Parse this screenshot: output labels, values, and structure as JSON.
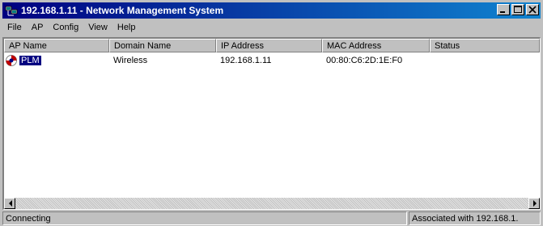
{
  "window": {
    "title": "192.168.1.11 - Network Management System",
    "icon": "network-computers-icon"
  },
  "menu": {
    "items": [
      "File",
      "AP",
      "Config",
      "View",
      "Help"
    ]
  },
  "table": {
    "columns": [
      "AP Name",
      "Domain Name",
      "IP Address",
      "MAC Address",
      "Status"
    ],
    "rows": [
      {
        "icon": "access-point-icon",
        "ap_name": "PLM",
        "domain_name": "Wireless",
        "ip_address": "192.168.1.11",
        "mac_address": "00:80:C6:2D:1E:F0",
        "status": ""
      }
    ],
    "selected_row": 0
  },
  "status_bar": {
    "left": "Connecting",
    "right": "Associated with 192.168.1."
  },
  "colors": {
    "title_start": "#000080",
    "title_end": "#1084d0",
    "selection": "#000080",
    "face": "#c0c0c0"
  }
}
